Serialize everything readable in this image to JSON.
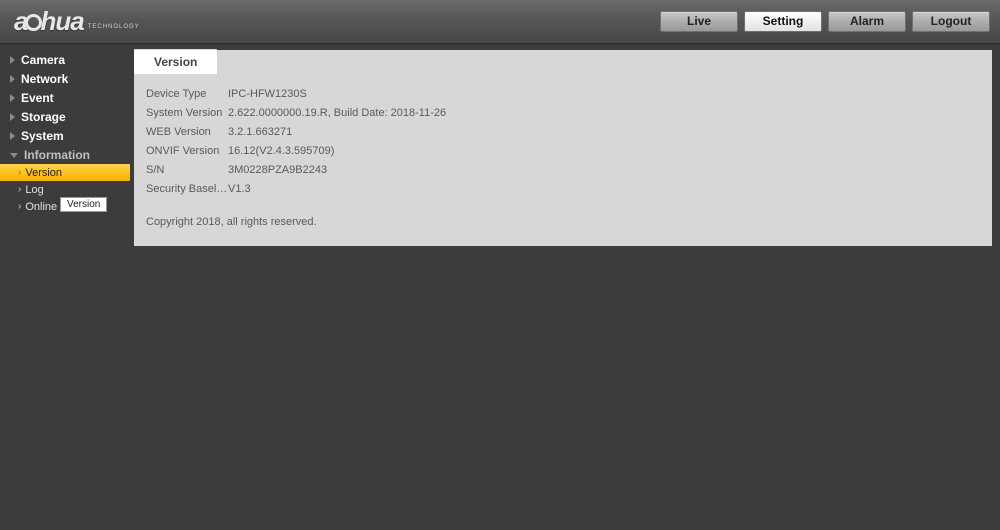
{
  "brand": {
    "name_part1": "a",
    "name_part2": "hua",
    "tagline": "TECHNOLOGY"
  },
  "nav": {
    "live": "Live",
    "setting": "Setting",
    "alarm": "Alarm",
    "logout": "Logout"
  },
  "sidebar": {
    "camera": "Camera",
    "network": "Network",
    "event": "Event",
    "storage": "Storage",
    "system": "System",
    "information": "Information",
    "sub": {
      "version": "Version",
      "log": "Log",
      "online_user": "Online User"
    },
    "tooltip": "Version"
  },
  "tab": {
    "title": "Version"
  },
  "fields": {
    "device_type": {
      "label": "Device Type",
      "value": "IPC-HFW1230S"
    },
    "system_version": {
      "label": "System Version",
      "value": "2.622.0000000.19.R, Build Date: 2018-11-26"
    },
    "web_version": {
      "label": "WEB Version",
      "value": "3.2.1.663271"
    },
    "onvif_version": {
      "label": "ONVIF Version",
      "value": "16.12(V2.4.3.595709)"
    },
    "sn": {
      "label": "S/N",
      "value": "3M0228PZA9B2243"
    },
    "baseline": {
      "label": "Security Baseline V...",
      "value": "V1.3"
    }
  },
  "copyright": "Copyright 2018, all rights reserved."
}
